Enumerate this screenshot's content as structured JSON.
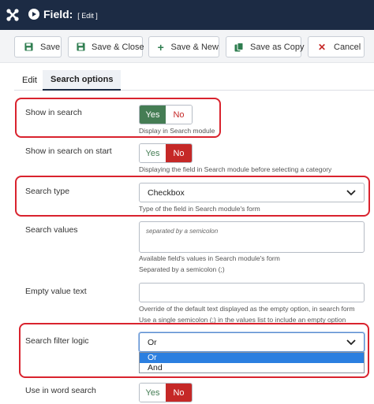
{
  "header": {
    "title": "Field:",
    "subtitle": "[ Edit ]"
  },
  "toolbar": {
    "save": "Save",
    "save_close": "Save & Close",
    "save_new": "Save & New",
    "save_copy": "Save as Copy",
    "cancel": "Cancel"
  },
  "tabs": [
    {
      "label": "Edit"
    },
    {
      "label": "Search options"
    }
  ],
  "fields": {
    "show_in_search": {
      "label": "Show in search",
      "yes": "Yes",
      "no": "No",
      "value": "Yes",
      "help": "Display in Search module"
    },
    "show_on_start": {
      "label": "Show in search on start",
      "yes": "Yes",
      "no": "No",
      "value": "No",
      "help": "Displaying the field in Search module before selecting a category"
    },
    "search_type": {
      "label": "Search type",
      "value": "Checkbox",
      "help": "Type of the field in Search module's form"
    },
    "search_values": {
      "label": "Search values",
      "placeholder": "separated by a semicolon",
      "help1": "Available field's values in Search module's form",
      "help2": "Separated by a semicolon (;)"
    },
    "empty_value": {
      "label": "Empty value text",
      "value": "",
      "help1": "Override of the default text displayed as the empty option, in search form",
      "help2": "Use a single semicolon (;) in the values list to include an empty option"
    },
    "filter_logic": {
      "label": "Search filter logic",
      "value": "Or",
      "options": [
        "Or",
        "And"
      ]
    },
    "word_search": {
      "label": "Use in word search",
      "yes": "Yes",
      "no": "No",
      "value": "No"
    }
  },
  "colors": {
    "header_bg": "#1c2b44",
    "yes_green": "#457d54",
    "no_red": "#c52827",
    "highlight": "#d9232e",
    "option_selected": "#2b7fe0"
  },
  "icons": {
    "logo": "joomla-logo",
    "title": "play-circle-icon",
    "save": "floppy-icon",
    "save_close": "floppy-icon",
    "save_new": "plus-icon",
    "save_copy": "copy-icon",
    "cancel": "close-icon"
  }
}
